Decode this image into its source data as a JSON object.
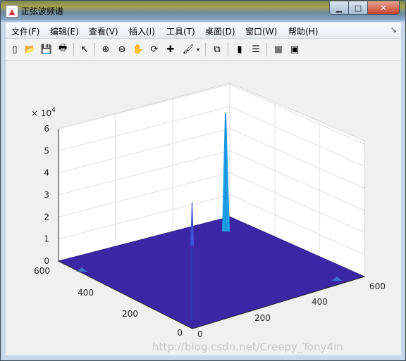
{
  "window": {
    "title": "正弦波频谱"
  },
  "menu": [
    "文件(F)",
    "编辑(E)",
    "查看(V)",
    "插入(I)",
    "工具(T)",
    "桌面(D)",
    "窗口(W)",
    "帮助(H)"
  ],
  "colors": {
    "surface": "#3b27a6",
    "spike": "#1ea0e8",
    "background": "#f0f0f0"
  },
  "toolbar": [
    {
      "name": "new-figure-icon",
      "glyph": "▯"
    },
    {
      "name": "open-file-icon",
      "glyph": "📂"
    },
    {
      "name": "save-icon",
      "glyph": "💾"
    },
    {
      "name": "print-icon",
      "glyph": "🖶"
    },
    {
      "name": "pointer-icon",
      "glyph": "↖"
    },
    {
      "name": "zoom-in-icon",
      "glyph": "⊕"
    },
    {
      "name": "zoom-out-icon",
      "glyph": "⊖"
    },
    {
      "name": "pan-icon",
      "glyph": "✋"
    },
    {
      "name": "rotate-3d-icon",
      "glyph": "⟳"
    },
    {
      "name": "data-cursor-icon",
      "glyph": "✚"
    },
    {
      "name": "brush-icon",
      "glyph": "🖌"
    },
    {
      "name": "link-plot-icon",
      "glyph": "⧉"
    },
    {
      "name": "colorbar-icon",
      "glyph": "▮"
    },
    {
      "name": "legend-icon",
      "glyph": "☰"
    },
    {
      "name": "hide-plot-tools-icon",
      "glyph": "■"
    },
    {
      "name": "show-plot-tools-icon",
      "glyph": "▣"
    }
  ],
  "chart_data": {
    "type": "surface",
    "z_exponent_label": "× 10",
    "z_exponent_power": "4",
    "z_ticks": [
      "0",
      "1",
      "2",
      "3",
      "4",
      "5",
      "6"
    ],
    "z_lim": [
      0,
      60000
    ],
    "x_ticks": [
      "0",
      "200",
      "400",
      "600"
    ],
    "y_ticks": [
      "0",
      "200",
      "400",
      "600"
    ],
    "x_lim": [
      0,
      600
    ],
    "y_lim": [
      0,
      600
    ],
    "grid": true,
    "peaks": [
      {
        "x": 300,
        "y": 300,
        "z": 59000
      },
      {
        "x": 150,
        "y": 120,
        "z": 28000
      }
    ]
  },
  "watermark": "http://blog.csdn.net/Creepy_Tony4in"
}
